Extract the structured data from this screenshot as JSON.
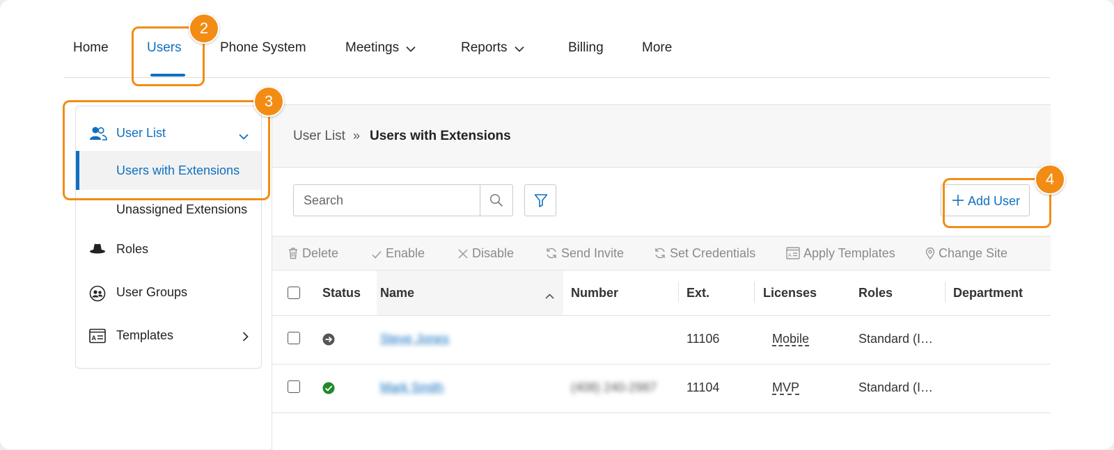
{
  "topnav": {
    "items": [
      {
        "label": "Home"
      },
      {
        "label": "Users",
        "active": true
      },
      {
        "label": "Phone System"
      },
      {
        "label": "Meetings",
        "has_dropdown": true
      },
      {
        "label": "Reports",
        "has_dropdown": true
      },
      {
        "label": "Billing"
      },
      {
        "label": "More"
      }
    ]
  },
  "callouts": [
    "2",
    "3",
    "4"
  ],
  "sidebar": {
    "user_list": "User List",
    "users_with_extensions": "Users with Extensions",
    "unassigned_extensions": "Unassigned Extensions",
    "roles": "Roles",
    "user_groups": "User Groups",
    "templates": "Templates"
  },
  "breadcrumb": {
    "parent": "User List",
    "separator": "»",
    "current": "Users with Extensions"
  },
  "search": {
    "placeholder": "Search"
  },
  "add_user": {
    "label": "Add User"
  },
  "toolbar": {
    "delete": "Delete",
    "enable": "Enable",
    "disable": "Disable",
    "send_invite": "Send Invite",
    "set_credentials": "Set Credentials",
    "apply_templates": "Apply Templates",
    "change_site": "Change Site"
  },
  "table": {
    "columns": {
      "status": "Status",
      "name": "Name",
      "number": "Number",
      "ext": "Ext.",
      "licenses": "Licenses",
      "roles": "Roles",
      "department": "Department"
    },
    "rows": [
      {
        "status": "redirect",
        "name": "Steve Jones",
        "number": "",
        "ext": "11106",
        "license": "Mobile",
        "role": "Standard (I…",
        "department": ""
      },
      {
        "status": "active",
        "name": "Mark Smith",
        "number": "(408) 240-2987",
        "ext": "11104",
        "license": "MVP",
        "role": "Standard (I…",
        "department": ""
      }
    ]
  },
  "colors": {
    "accent": "#0f6fc0",
    "callout": "#f28c14",
    "status_active": "#1f8a2a",
    "status_redirect": "#555555"
  }
}
